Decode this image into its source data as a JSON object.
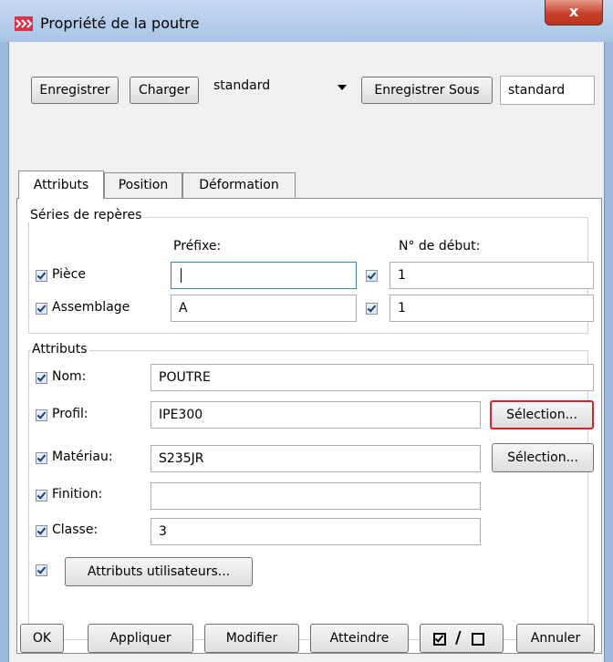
{
  "window": {
    "title": "Propriété de la poutre",
    "close_glyph": "x"
  },
  "toolbar": {
    "save_label": "Enregistrer",
    "load_label": "Charger",
    "preset_value": "standard",
    "save_as_label": "Enregistrer Sous",
    "save_as_value": "standard"
  },
  "tabs": [
    {
      "label": "Attributs",
      "active": true
    },
    {
      "label": "Position",
      "active": false
    },
    {
      "label": "Déformation",
      "active": false
    }
  ],
  "numbering": {
    "group_label": "Séries de repères",
    "prefix_header": "Préfixe:",
    "start_header": "N° de début:",
    "rows": [
      {
        "label": "Pièce",
        "prefix": "",
        "start": "1",
        "checked": true,
        "start_checked": true
      },
      {
        "label": "Assemblage",
        "prefix": "A",
        "start": "1",
        "checked": true,
        "start_checked": true
      }
    ]
  },
  "attributes": {
    "group_label": "Attributs",
    "name_label": "Nom:",
    "name_value": "POUTRE",
    "profile_label": "Profil:",
    "profile_value": "IPE300",
    "profile_select_label": "Sélection...",
    "material_label": "Matériau:",
    "material_value": "S235JR",
    "material_select_label": "Sélection...",
    "finish_label": "Finition:",
    "finish_value": "",
    "class_label": "Classe:",
    "class_value": "3",
    "user_attributes_label": "Attributs utilisateurs..."
  },
  "footer": {
    "ok_label": "OK",
    "apply_label": "Appliquer",
    "modify_label": "Modifier",
    "get_label": "Atteindre",
    "toggle_slash": "/",
    "cancel_label": "Annuler"
  },
  "colors": {
    "highlight_border": "#e0202a",
    "title_bar": "#a9c4e6",
    "close_button": "#c6402b"
  }
}
